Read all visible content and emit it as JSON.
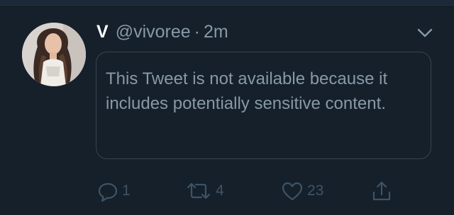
{
  "tweet": {
    "display_name": "V",
    "handle": "@vivoree",
    "separator": "·",
    "time": "2m",
    "notice": "This Tweet is not available because it includes potentially sensitive content."
  },
  "actions": {
    "reply_count": "1",
    "retweet_count": "4",
    "like_count": "23"
  },
  "icons": {
    "menu": "chevron-down-icon",
    "reply": "reply-icon",
    "retweet": "retweet-icon",
    "like": "heart-icon",
    "share": "share-icon"
  },
  "colors": {
    "background": "#15202b",
    "secondary_text": "#8899a6",
    "border": "#38444d",
    "action_icons": "#3d5466"
  }
}
